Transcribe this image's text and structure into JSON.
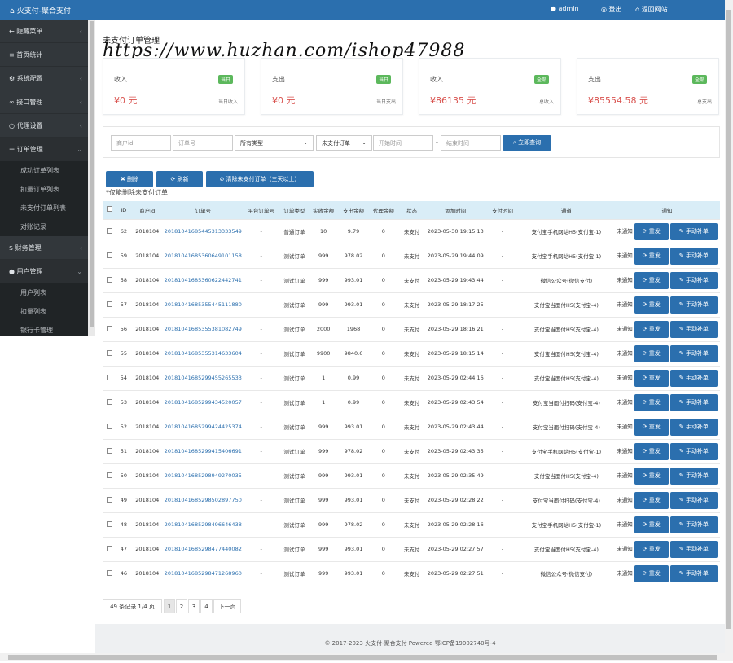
{
  "header": {
    "brand": "火支付-聚合支付",
    "admin": "admin",
    "logout": "登出",
    "back_site": "返回网站"
  },
  "sidebar": {
    "items": [
      {
        "label": "隐藏菜单",
        "icon": "arrow-left-icon"
      },
      {
        "label": "首页统计",
        "icon": "bars-icon"
      },
      {
        "label": "系统配置",
        "icon": "gear-icon"
      },
      {
        "label": "接口管理",
        "icon": "link-icon"
      },
      {
        "label": "代理设置",
        "icon": "circle-icon"
      },
      {
        "label": "订单管理",
        "icon": "list-icon"
      },
      {
        "label": "财务管理",
        "icon": "dollar-icon"
      },
      {
        "label": "用户管理",
        "icon": "user-icon"
      }
    ],
    "order_sub": [
      "成功订单列表",
      "扣量订单列表",
      "未支付订单列表",
      "对账记录"
    ],
    "user_sub": [
      "用户列表",
      "扣量列表",
      "银行卡管理"
    ]
  },
  "page": {
    "title": "未支付订单管理",
    "watermark": "https://www.huzhan.com/ishop47988"
  },
  "stats": [
    {
      "label": "收入",
      "badge": "当日",
      "value": "¥0 元",
      "sub": "当日收入"
    },
    {
      "label": "支出",
      "badge": "当日",
      "value": "¥0 元",
      "sub": "当日支出"
    },
    {
      "label": "收入",
      "badge": "全部",
      "value": "¥86135 元",
      "sub": "总收入"
    },
    {
      "label": "支出",
      "badge": "全部",
      "value": "¥85554.58 元",
      "sub": "总支出"
    }
  ],
  "filter": {
    "merchant_placeholder": "商户id",
    "order_placeholder": "订单号",
    "type_select": "所有类型",
    "status_select": "未支付订单",
    "start_placeholder": "开始时间",
    "dash": "-",
    "end_placeholder": "结束时间",
    "search_label": "立即查询"
  },
  "actions": {
    "delete": "删除",
    "refresh": "刷新",
    "clear": "清除未支付订单（三天以上）",
    "note": "*仅能删除未支付订单"
  },
  "table": {
    "columns": [
      "ID",
      "商户id",
      "订单号",
      "平台订单号",
      "订单类型",
      "实收金额",
      "支出金额",
      "代理金额",
      "状态",
      "添加时间",
      "支付时间",
      "通道",
      "通知"
    ],
    "resend": "重发",
    "manual": "手动补单",
    "notify_status": "未通知",
    "rows": [
      [
        "62",
        "2018104",
        "20181041685445313333549",
        "-",
        "普通订单",
        "10",
        "9.79",
        "0",
        "未支付",
        "2023-05-30 19:15:13",
        "-",
        "支付宝手机网站H5(支付宝-1)"
      ],
      [
        "59",
        "2018104",
        "20181041685360649101158",
        "-",
        "测试订单",
        "999",
        "978.02",
        "0",
        "未支付",
        "2023-05-29 19:44:09",
        "-",
        "支付宝手机网站H5(支付宝-1)"
      ],
      [
        "58",
        "2018104",
        "20181041685360622442741",
        "-",
        "测试订单",
        "999",
        "993.01",
        "0",
        "未支付",
        "2023-05-29 19:43:44",
        "-",
        "微信公众号(微信支付)"
      ],
      [
        "57",
        "2018104",
        "20181041685355445111880",
        "-",
        "测试订单",
        "999",
        "993.01",
        "0",
        "未支付",
        "2023-05-29 18:17:25",
        "-",
        "支付宝当面付H5(支付宝-4)"
      ],
      [
        "56",
        "2018104",
        "20181041685355381082749",
        "-",
        "测试订单",
        "2000",
        "1968",
        "0",
        "未支付",
        "2023-05-29 18:16:21",
        "-",
        "支付宝当面付H5(支付宝-4)"
      ],
      [
        "55",
        "2018104",
        "20181041685355314633604",
        "-",
        "测试订单",
        "9900",
        "9840.6",
        "0",
        "未支付",
        "2023-05-29 18:15:14",
        "-",
        "支付宝当面付H5(支付宝-4)"
      ],
      [
        "54",
        "2018104",
        "20181041685299455265533",
        "-",
        "测试订单",
        "1",
        "0.99",
        "0",
        "未支付",
        "2023-05-29 02:44:16",
        "-",
        "支付宝当面付H5(支付宝-4)"
      ],
      [
        "53",
        "2018104",
        "20181041685299434520057",
        "-",
        "测试订单",
        "1",
        "0.99",
        "0",
        "未支付",
        "2023-05-29 02:43:54",
        "-",
        "支付宝当面付扫码(支付宝-4)"
      ],
      [
        "52",
        "2018104",
        "20181041685299424425374",
        "-",
        "测试订单",
        "999",
        "993.01",
        "0",
        "未支付",
        "2023-05-29 02:43:44",
        "-",
        "支付宝当面付扫码(支付宝-4)"
      ],
      [
        "51",
        "2018104",
        "20181041685299415406691",
        "-",
        "测试订单",
        "999",
        "978.02",
        "0",
        "未支付",
        "2023-05-29 02:43:35",
        "-",
        "支付宝手机网站H5(支付宝-1)"
      ],
      [
        "50",
        "2018104",
        "20181041685298949270035",
        "-",
        "测试订单",
        "999",
        "993.01",
        "0",
        "未支付",
        "2023-05-29 02:35:49",
        "-",
        "支付宝当面付H5(支付宝-4)"
      ],
      [
        "49",
        "2018104",
        "20181041685298502897750",
        "-",
        "测试订单",
        "999",
        "993.01",
        "0",
        "未支付",
        "2023-05-29 02:28:22",
        "-",
        "支付宝当面付扫码(支付宝-4)"
      ],
      [
        "48",
        "2018104",
        "20181041685298496646438",
        "-",
        "测试订单",
        "999",
        "978.02",
        "0",
        "未支付",
        "2023-05-29 02:28:16",
        "-",
        "支付宝手机网站H5(支付宝-1)"
      ],
      [
        "47",
        "2018104",
        "20181041685298477440082",
        "-",
        "测试订单",
        "999",
        "993.01",
        "0",
        "未支付",
        "2023-05-29 02:27:57",
        "-",
        "支付宝当面付H5(支付宝-4)"
      ],
      [
        "46",
        "2018104",
        "20181041685298471268960",
        "-",
        "测试订单",
        "999",
        "993.01",
        "0",
        "未支付",
        "2023-05-29 02:27:51",
        "-",
        "微信公众号(微信支付)"
      ]
    ]
  },
  "pagination": {
    "summary": "49 条记录 1/4 页",
    "pages": [
      "1",
      "2",
      "3",
      "4"
    ],
    "next": "下一页"
  },
  "footer": {
    "text": "© 2017-2023 火支付-聚合支付 Powered 鄂ICP备19002740号-4"
  },
  "colors": {
    "primary": "#2b6fae",
    "sidebar": "#32373b",
    "badge": "#5cb85c",
    "money": "#d9534f",
    "table_head": "#d9edf7"
  }
}
